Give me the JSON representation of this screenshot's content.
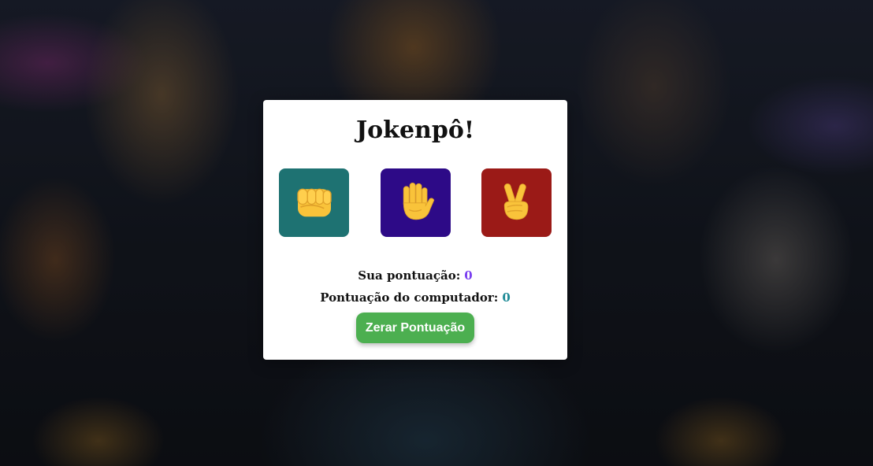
{
  "title": "Jokenpô!",
  "choices": [
    {
      "name": "rock",
      "icon": "fist-icon",
      "color": "#1e7272"
    },
    {
      "name": "paper",
      "icon": "raised-hand-icon",
      "color": "#2d0a87"
    },
    {
      "name": "scissors",
      "icon": "victory-hand-icon",
      "color": "#9b1a17"
    }
  ],
  "score": {
    "user_label": "Sua pontuação:",
    "user_value": "0",
    "user_value_color": "#7a3ff0",
    "cpu_label": "Pontuação do computador:",
    "cpu_value": "0",
    "cpu_value_color": "#1e8a96"
  },
  "reset_button": {
    "label": "Zerar Pontuação",
    "color": "#4caf50"
  }
}
